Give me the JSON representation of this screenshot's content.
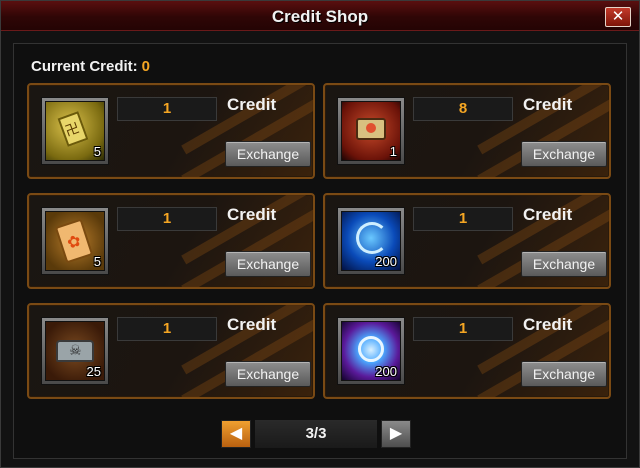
{
  "window": {
    "title": "Credit Shop",
    "close_label": "✕"
  },
  "credit": {
    "label": "Current Credit:",
    "value": "0"
  },
  "items": [
    {
      "price": "1",
      "unit": "Credit",
      "qty": "5",
      "icon": "talisman-icon",
      "button": "Exchange"
    },
    {
      "price": "8",
      "unit": "Credit",
      "qty": "1",
      "icon": "gift-pack-icon",
      "button": "Exchange"
    },
    {
      "price": "1",
      "unit": "Credit",
      "qty": "5",
      "icon": "pet-card-icon",
      "button": "Exchange"
    },
    {
      "price": "1",
      "unit": "Credit",
      "qty": "200",
      "icon": "blue-soul-icon",
      "button": "Exchange"
    },
    {
      "price": "1",
      "unit": "Credit",
      "qty": "25",
      "icon": "skull-chest-icon",
      "button": "Exchange"
    },
    {
      "price": "1",
      "unit": "Credit",
      "qty": "200",
      "icon": "spirit-orb-icon",
      "button": "Exchange"
    }
  ],
  "pager": {
    "prev": "◀",
    "label": "3/3",
    "next": "▶"
  },
  "colors": {
    "accent": "#f5a623",
    "title_bar": "#5a0f0f",
    "card_border": "#7a4a14"
  }
}
